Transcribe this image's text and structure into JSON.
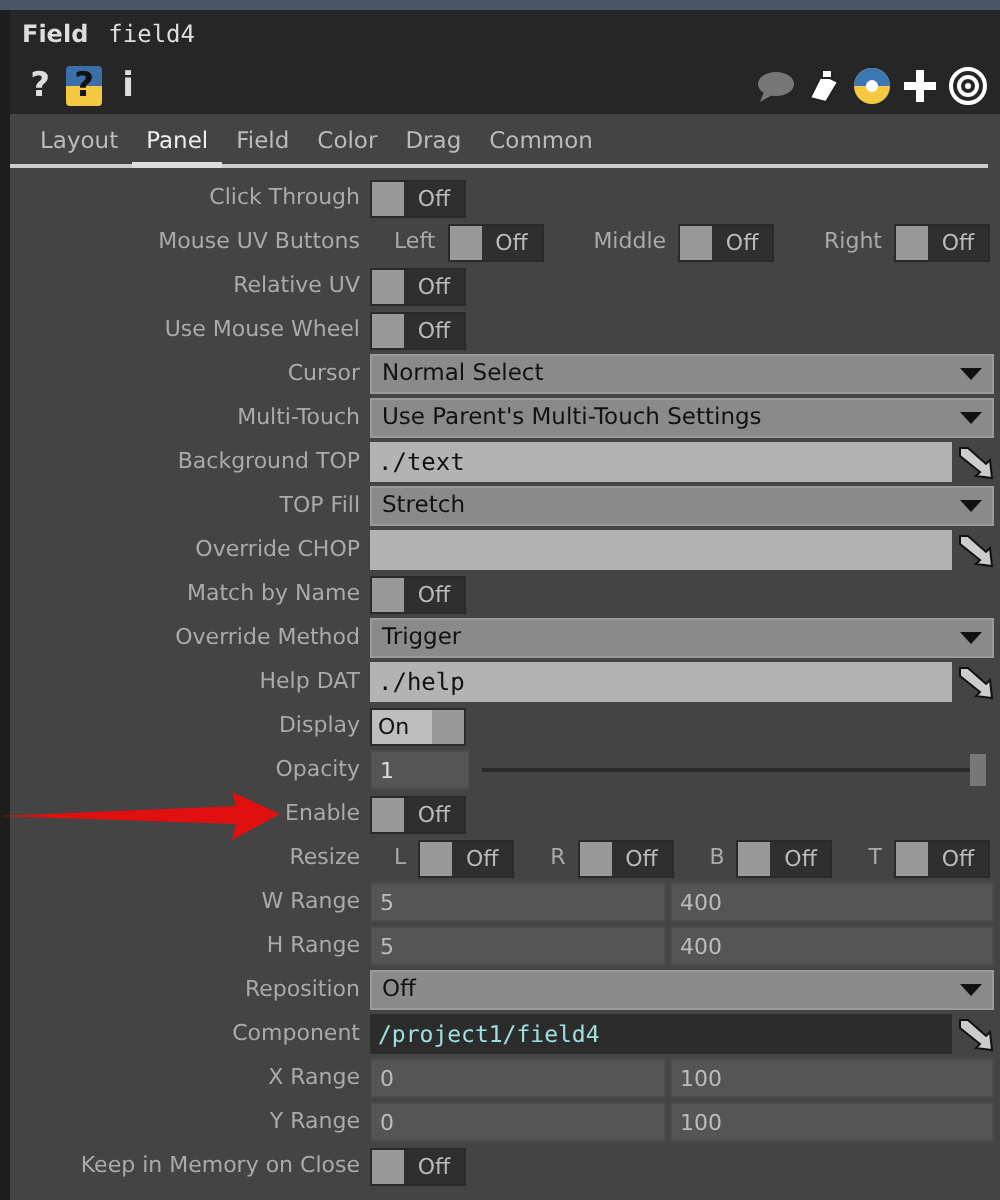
{
  "title": {
    "type": "Field",
    "name": "field4"
  },
  "toolbar": [
    {
      "kind": "help",
      "text": "?"
    },
    {
      "kind": "python_help",
      "text": "?"
    },
    {
      "kind": "info",
      "text": "i"
    }
  ],
  "tabs": [
    {
      "label": "Layout",
      "selected": false
    },
    {
      "label": "Panel",
      "selected": true
    },
    {
      "label": "Field",
      "selected": false
    },
    {
      "label": "Color",
      "selected": false
    },
    {
      "label": "Drag",
      "selected": false
    },
    {
      "label": "Common",
      "selected": false
    }
  ],
  "params": [
    {
      "kind": "toggle",
      "label": "Click Through",
      "value": "Off",
      "on": false
    },
    {
      "kind": "toggles",
      "label": "Mouse UV Buttons",
      "items": [
        {
          "label": "Left",
          "value": "Off",
          "on": false
        },
        {
          "label": "Middle",
          "value": "Off",
          "on": false
        },
        {
          "label": "Right",
          "value": "Off",
          "on": false
        }
      ]
    },
    {
      "kind": "toggle",
      "label": "Relative UV",
      "value": "Off",
      "on": false
    },
    {
      "kind": "toggle",
      "label": "Use Mouse Wheel",
      "value": "Off",
      "on": false
    },
    {
      "kind": "menu",
      "label": "Cursor",
      "value": "Normal Select"
    },
    {
      "kind": "menu",
      "label": "Multi-Touch",
      "value": "Use Parent's Multi-Touch Settings"
    },
    {
      "kind": "ref",
      "label": "Background TOP",
      "value": "./text"
    },
    {
      "kind": "menu",
      "label": "TOP Fill",
      "value": "Stretch"
    },
    {
      "kind": "ref",
      "label": "Override CHOP"
    },
    {
      "kind": "toggle",
      "label": "Match by Name",
      "value": "Off",
      "on": false
    },
    {
      "kind": "menu",
      "label": "Override Method",
      "value": "Trigger"
    },
    {
      "kind": "ref",
      "label": "Help DAT",
      "value": "./help"
    },
    {
      "kind": "toggle",
      "label": "Display",
      "value": "On",
      "on": true
    },
    {
      "kind": "slider",
      "label": "Opacity",
      "value": "1",
      "level": 1
    },
    {
      "kind": "toggle",
      "label": "Enable",
      "value": "Off",
      "on": false,
      "pointer": true
    },
    {
      "kind": "toggles",
      "label": "Resize",
      "items": [
        {
          "label": "L",
          "value": "Off",
          "on": false
        },
        {
          "label": "R",
          "value": "Off",
          "on": false
        },
        {
          "label": "B",
          "value": "Off",
          "on": false
        },
        {
          "label": "T",
          "value": "Off",
          "on": false
        }
      ]
    },
    {
      "kind": "pair",
      "label": "W Range",
      "values": [
        "5",
        "400"
      ]
    },
    {
      "kind": "pair",
      "label": "H Range",
      "values": [
        "5",
        "400"
      ]
    },
    {
      "kind": "menu",
      "label": "Reposition",
      "value": "Off"
    },
    {
      "kind": "path",
      "label": "Component",
      "value": "/project1/field4"
    },
    {
      "kind": "pair",
      "label": "X Range",
      "values": [
        "0",
        "100"
      ]
    },
    {
      "kind": "pair",
      "label": "Y Range",
      "values": [
        "0",
        "100"
      ]
    },
    {
      "kind": "toggle",
      "label": "Keep in Memory on Close",
      "value": "Off",
      "on": false
    }
  ]
}
